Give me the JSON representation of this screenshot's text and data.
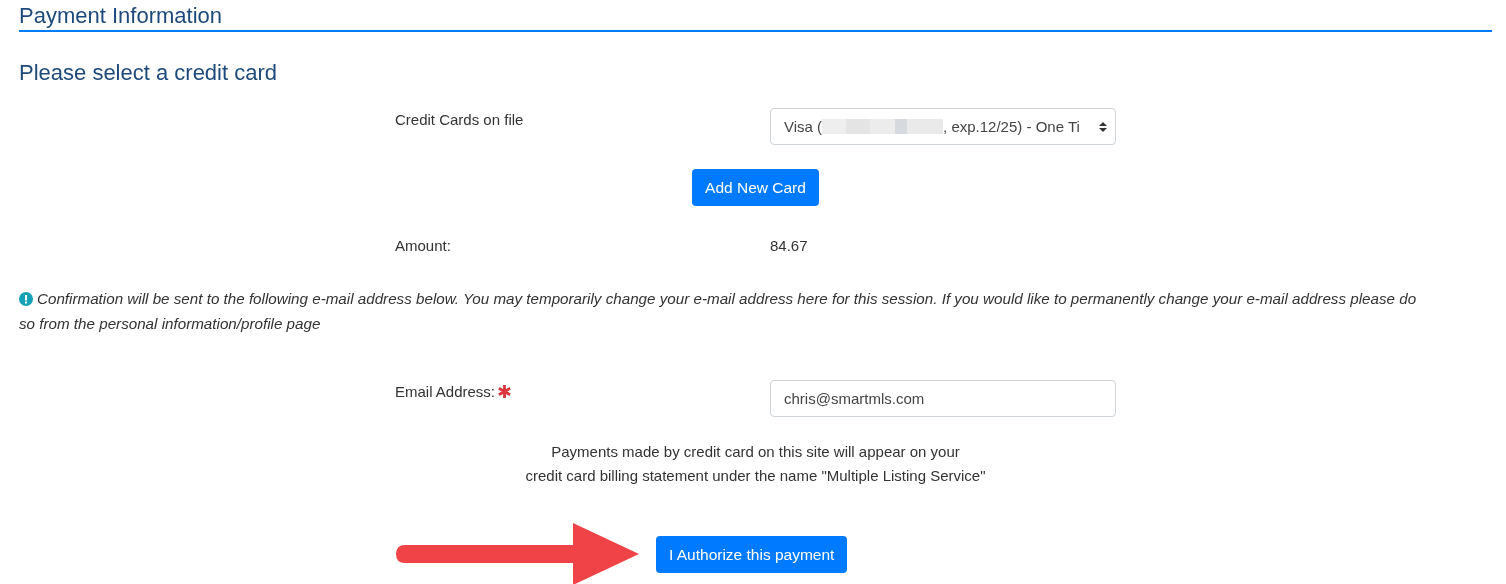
{
  "page_title": "Payment Information",
  "section_title": "Please select a credit card",
  "card_field": {
    "label": "Credit Cards on file",
    "value_start": "Visa (",
    "value_end": ", exp.12/25) - One Ti"
  },
  "add_card_button": "Add New Card",
  "amount": {
    "label": "Amount:",
    "value": "84.67"
  },
  "notice": [
    "Confirmation will be sent to the following e-mail address below. You may temporarily change your e-mail address here for this session. If you would like to permanently change your e-mail address please do",
    "so from the personal information/profile page"
  ],
  "email_field": {
    "label": "Email Address:",
    "required": true,
    "value": "chris@smartmls.com"
  },
  "billing_note": [
    "Payments made by credit card on this site will appear on your",
    "credit card billing statement under the name \"Multiple Listing Service\""
  ],
  "authorize_button": "I Authorize this payment"
}
